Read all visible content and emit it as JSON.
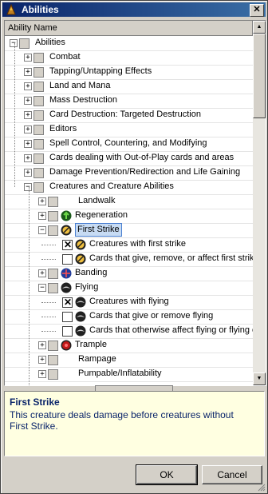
{
  "window": {
    "title": "Abilities"
  },
  "tree": {
    "column_header": "Ability Name",
    "rows": [
      {
        "label": "Abilities",
        "level": 0,
        "expander": "minus",
        "checkbox": "gray",
        "icon": null
      },
      {
        "label": "Combat",
        "level": 1,
        "expander": "plus",
        "checkbox": "gray",
        "icon": null
      },
      {
        "label": "Tapping/Untapping Effects",
        "level": 1,
        "expander": "plus",
        "checkbox": "gray",
        "icon": null
      },
      {
        "label": "Land and Mana",
        "level": 1,
        "expander": "plus",
        "checkbox": "gray",
        "icon": null
      },
      {
        "label": "Mass Destruction",
        "level": 1,
        "expander": "plus",
        "checkbox": "gray",
        "icon": null
      },
      {
        "label": "Card Destruction: Targeted Destruction",
        "level": 1,
        "expander": "plus",
        "checkbox": "gray",
        "icon": null
      },
      {
        "label": "Editors",
        "level": 1,
        "expander": "plus",
        "checkbox": "gray",
        "icon": null
      },
      {
        "label": "Spell Control, Countering, and Modifying",
        "level": 1,
        "expander": "plus",
        "checkbox": "gray",
        "icon": null
      },
      {
        "label": "Cards dealing with Out-of-Play cards and areas",
        "level": 1,
        "expander": "plus",
        "checkbox": "gray",
        "icon": null
      },
      {
        "label": "Damage Prevention/Redirection and Life Gaining",
        "level": 1,
        "expander": "plus",
        "checkbox": "gray",
        "icon": null
      },
      {
        "label": "Creatures and Creature Abilities",
        "level": 1,
        "expander": "minus",
        "checkbox": "gray",
        "icon": null
      },
      {
        "label": "Landwalk",
        "level": 2,
        "expander": "plus",
        "checkbox": "gray",
        "icon": null
      },
      {
        "label": "Regeneration",
        "level": 2,
        "expander": "plus",
        "checkbox": "gray",
        "icon": "regeneration-icon"
      },
      {
        "label": "First Strike",
        "level": 2,
        "expander": "minus",
        "checkbox": "gray",
        "icon": "first-strike-icon",
        "selected": true
      },
      {
        "label": "Creatures with first strike",
        "level": 3,
        "expander": null,
        "checkbox": "checked",
        "icon": "first-strike-icon"
      },
      {
        "label": "Cards that give, remove, or affect first strike",
        "level": 3,
        "expander": null,
        "checkbox": "empty",
        "icon": "first-strike-icon"
      },
      {
        "label": "Banding",
        "level": 2,
        "expander": "plus",
        "checkbox": "gray",
        "icon": "banding-icon"
      },
      {
        "label": "Flying",
        "level": 2,
        "expander": "minus",
        "checkbox": "gray",
        "icon": "flying-icon"
      },
      {
        "label": "Creatures with flying",
        "level": 3,
        "expander": null,
        "checkbox": "checked",
        "icon": "flying-icon"
      },
      {
        "label": "Cards that give or remove flying",
        "level": 3,
        "expander": null,
        "checkbox": "empty",
        "icon": "flying-icon"
      },
      {
        "label": "Cards that otherwise affect flying or flying creatures",
        "level": 3,
        "expander": null,
        "checkbox": "empty",
        "icon": "flying-icon"
      },
      {
        "label": "Trample",
        "level": 2,
        "expander": "plus",
        "checkbox": "gray",
        "icon": "trample-icon"
      },
      {
        "label": "Rampage",
        "level": 2,
        "expander": "plus",
        "checkbox": "gray",
        "icon": null
      },
      {
        "label": "Pumpable/Inflatability",
        "level": 2,
        "expander": "plus",
        "checkbox": "gray",
        "icon": null
      }
    ]
  },
  "description": {
    "title": "First Strike",
    "body": "This creature deals damage before creatures without First Strike."
  },
  "buttons": {
    "ok": "OK",
    "cancel": "Cancel"
  },
  "colors": {
    "title_bar": "#0a246a",
    "selection": "#c7dbf3",
    "description_bg": "#ffffe1",
    "description_text": "#0a246a"
  }
}
